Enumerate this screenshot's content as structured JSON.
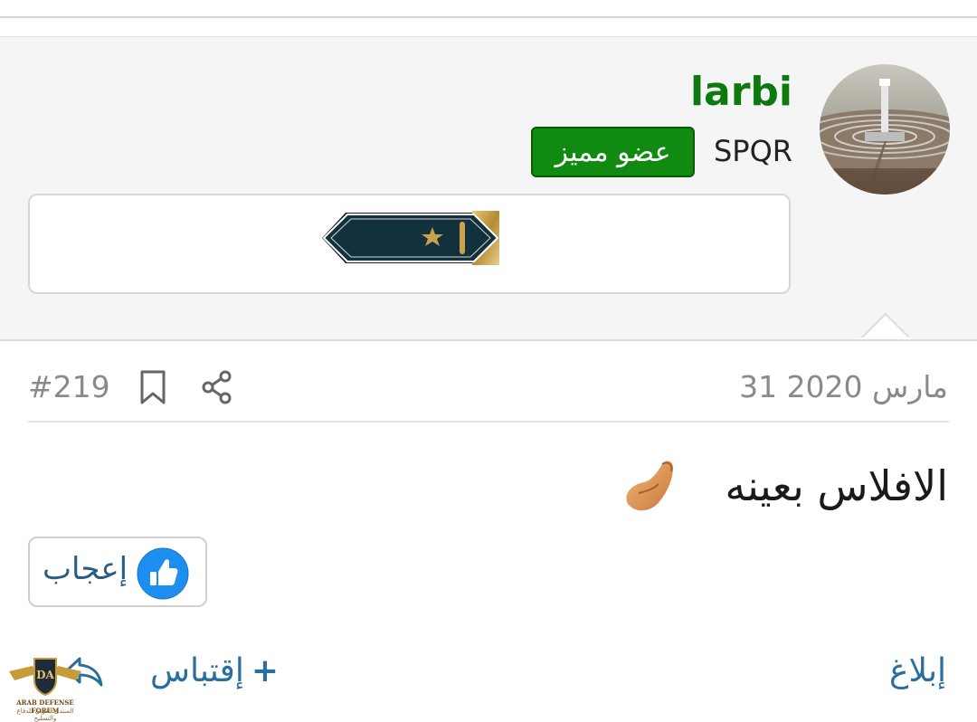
{
  "user": {
    "name": "larbi",
    "title": "SPQR",
    "badge": "عضو مميز",
    "avatar_icon": "solar-tower-avatar",
    "rank_icon": "rank-star-insignia"
  },
  "post": {
    "date": "31 مارس 2020",
    "number": "#219",
    "text": "الافلاس بعينه",
    "emoji_icon": "pinched-fingers-emoji"
  },
  "actions": {
    "like_label": "إعجاب",
    "report_label": "إبلاغ",
    "quote_label": "إقتباس",
    "quote_plus": "+"
  },
  "watermark": {
    "name": "ARAB DEFENSE FORUM",
    "arabic": "المنتدى العربي للدفاع والتسليح",
    "mark": "DA"
  },
  "colors": {
    "username": "#0e7a0e",
    "badge_bg": "#118a11",
    "link": "#2a6e9e",
    "like_icon": "#1d8ef0"
  }
}
